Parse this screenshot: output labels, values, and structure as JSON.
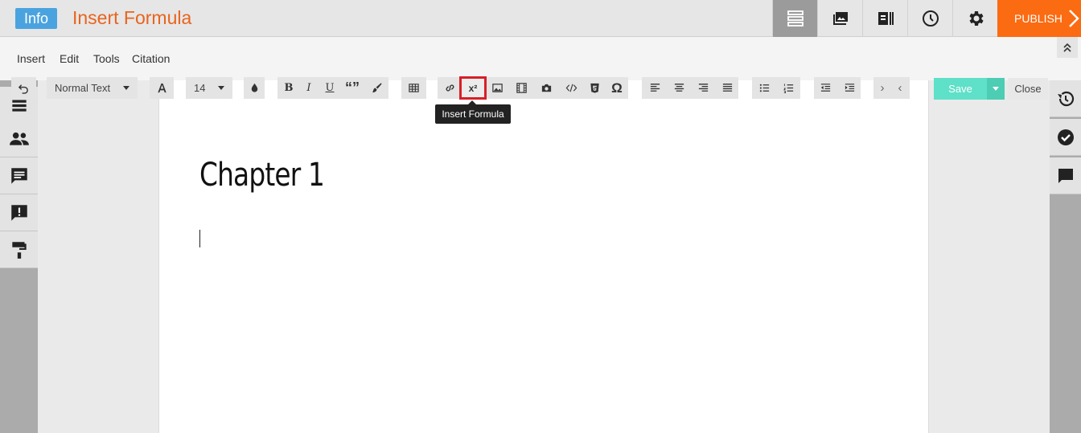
{
  "header": {
    "info_label": "Info",
    "title": "Insert Formula",
    "buttons": [
      "list-icon",
      "gallery-icon",
      "library-icon",
      "clock-icon",
      "gear-icon"
    ],
    "publish_label": "PUBLISH"
  },
  "menu": {
    "items": [
      "Insert",
      "Edit",
      "Tools",
      "Citation"
    ]
  },
  "toolbar": {
    "style_value": "Normal Text",
    "size_value": "14",
    "bold": "B",
    "italic": "I",
    "underline": "U",
    "quote": "“”",
    "formula_label": "x²",
    "omega": "Ω",
    "more_right": "›",
    "more_left": "‹",
    "save_label": "Save",
    "close_label": "Close"
  },
  "tooltip": "Insert Formula",
  "document": {
    "heading": "Chapter 1"
  },
  "colors": {
    "accent": "#fb6b12",
    "title": "#e8641e",
    "info": "#4aa3df",
    "save": "#5fe0c8",
    "highlight": "#d81f26"
  }
}
